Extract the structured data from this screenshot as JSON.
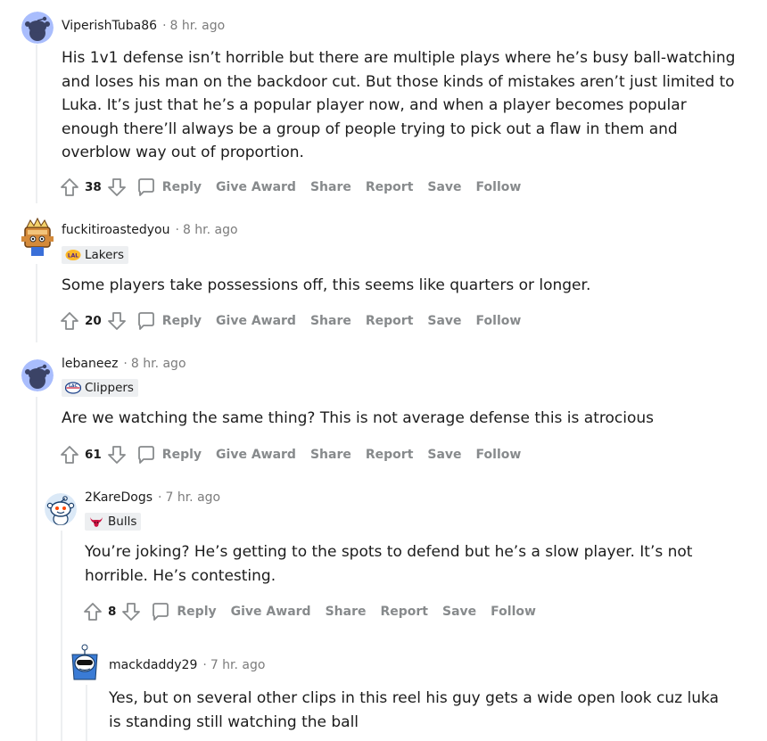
{
  "comments": [
    {
      "username": "ViperishTuba86",
      "time": "8 hr. ago",
      "flair": "",
      "body": "His 1v1 defense isn’t horrible but there are multiple plays where he’s busy ball-watching and loses his man on the backdoor cut. But those kinds of mistakes aren’t just limited to Luka. It’s just that he’s a popular player now, and when a player becomes popular enough there’ll always be a group of people trying to pick out a flaw in them and overblow way out of proportion.",
      "votes": "38"
    },
    {
      "username": "fuckitiroastedyou",
      "time": "8 hr. ago",
      "flair": "Lakers",
      "body": "Some players take possessions off, this seems like quarters or longer.",
      "votes": "20"
    },
    {
      "username": "lebaneez",
      "time": "8 hr. ago",
      "flair": "Clippers",
      "body": "Are we watching the same thing? This is not average defense this is atrocious",
      "votes": "61"
    },
    {
      "username": "2KareDogs",
      "time": "7 hr. ago",
      "flair": "Bulls",
      "body": "You’re joking? He’s getting to the spots to defend but he’s a slow player. It’s not horrible. He’s contesting.",
      "votes": "8"
    },
    {
      "username": "mackdaddy29",
      "time": "7 hr. ago",
      "flair": "",
      "body": "Yes, but on several other clips in this reel his guy gets a wide open look cuz luka is standing still watching the ball",
      "votes": ""
    }
  ],
  "actions": {
    "reply": "Reply",
    "give_award": "Give Award",
    "share": "Share",
    "report": "Report",
    "save": "Save",
    "follow": "Follow"
  },
  "separator": "·",
  "colors": {
    "lakers_purple": "#552583",
    "lakers_gold": "#fdb927",
    "clippers_blue": "#1d428a",
    "clippers_red": "#c8102e",
    "bulls_red": "#ce1141",
    "snoo_blue": "#8fa9ff",
    "action_gray": "#878a8c",
    "thread_line": "#edeff1"
  },
  "icons": [
    "upvote-icon",
    "downvote-icon",
    "comment-icon",
    "snoo-avatar-icon",
    "lakers-logo-icon",
    "clippers-logo-icon",
    "bulls-logo-icon"
  ]
}
